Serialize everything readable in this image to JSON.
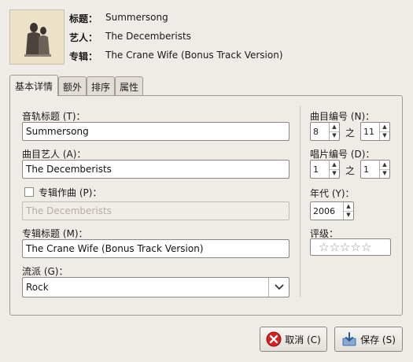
{
  "header": {
    "title_label": "标题：",
    "title_value": "Summersong",
    "artist_label": "艺人：",
    "artist_value": "The Decemberists",
    "album_label": "专辑：",
    "album_value": "The Crane Wife (Bonus Track Version)"
  },
  "tabs": [
    "基本详情",
    "额外",
    "排序",
    "属性"
  ],
  "form": {
    "track_title_label": "音轨标题 (T)：",
    "track_title_value": "Summersong",
    "track_artist_label": "曲目艺人 (A)：",
    "track_artist_value": "The Decemberists",
    "album_composer_label": "专辑作曲 (P)：",
    "album_composer_value": "The Decemberists",
    "album_title_label": "专辑标题 (M)：",
    "album_title_value": "The Crane Wife (Bonus Track Version)",
    "genre_label": "流派 (G)：",
    "genre_value": "Rock",
    "track_number_label": "曲目编号 (N)：",
    "track_number_value": "8",
    "track_of_label": "之",
    "track_total_value": "11",
    "disc_number_label": "唱片编号 (D)：",
    "disc_number_value": "1",
    "disc_of_label": "之",
    "disc_total_value": "1",
    "year_label": "年代 (Y)：",
    "year_value": "2006",
    "rating_label": "评级：",
    "rating_value": 0,
    "rating_max": 5
  },
  "buttons": {
    "cancel_label": "取消 (C)",
    "save_label": "保存 (S)"
  },
  "icons": {
    "cancel": "cancel-icon",
    "save": "save-icon",
    "cover": "album-cover",
    "dropdown": "chevron-down-icon"
  },
  "colors": {
    "window_bg": "#efebe7",
    "cancel_icon": "#d42020",
    "save_icon": "#3a6fb0"
  }
}
